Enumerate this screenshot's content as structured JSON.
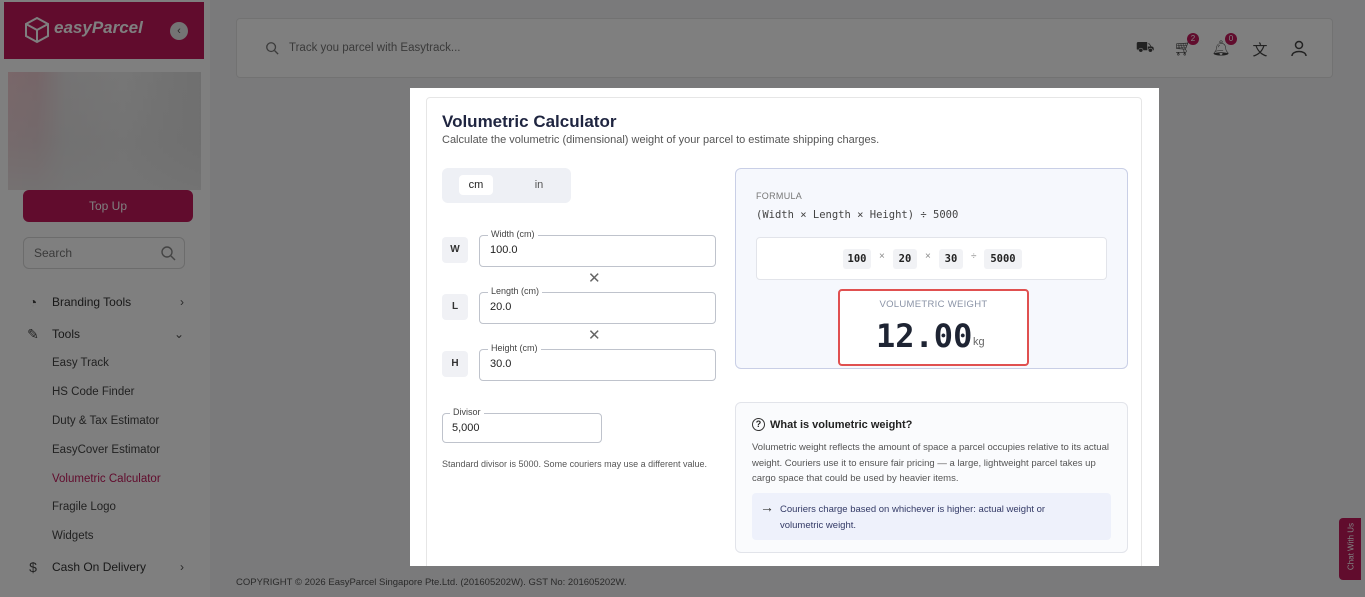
{
  "brand": {
    "name": "easyParcel"
  },
  "sidebar": {
    "topup_label": "Top Up",
    "search_placeholder": "Search",
    "items": [
      {
        "label": "Branding Tools",
        "icon": "palette-icon"
      },
      {
        "label": "Tools",
        "icon": "wrench-icon"
      },
      {
        "label": "Cash On Delivery",
        "icon": "dollar-icon"
      }
    ],
    "tools_subitems": [
      "Easy Track",
      "HS Code Finder",
      "Duty & Tax Estimator",
      "EasyCover Estimator",
      "Volumetric Calculator",
      "Fragile Logo",
      "Widgets"
    ]
  },
  "topbar": {
    "track_placeholder": "Track you parcel with Easytrack...",
    "cart_badge": "2",
    "bell_badge": "0"
  },
  "footer": {
    "text": "COPYRIGHT © 2026 EasyParcel Singapore Pte.Ltd. (201605202W). GST No: 201605202W."
  },
  "chat_label": "Chat With Us",
  "calculator": {
    "title": "Volumetric Calculator",
    "subtitle": "Calculate the volumetric (dimensional) weight of your parcel to estimate shipping charges.",
    "units": [
      "cm",
      "in"
    ],
    "selected_unit": "cm",
    "fields": [
      {
        "badge": "W",
        "label": "Width (cm)",
        "value": "100.0"
      },
      {
        "badge": "L",
        "label": "Length (cm)",
        "value": "20.0"
      },
      {
        "badge": "H",
        "label": "Height (cm)",
        "value": "30.0"
      }
    ],
    "times_symbol": "✕",
    "divisor": {
      "label": "Divisor",
      "value": "5,000"
    },
    "divisor_note": "Standard divisor is 5000. Some couriers may use a different value.",
    "formula": {
      "label": "FORMULA",
      "expression": "(Width × Length × Height) ÷ 5000",
      "values": [
        "100",
        "20",
        "30",
        "5000"
      ],
      "operators": [
        "×",
        "×",
        "÷"
      ]
    },
    "result": {
      "label": "VOLUMETRIC WEIGHT",
      "value": "12.00",
      "unit": "kg"
    },
    "info": {
      "title": "What is volumetric weight?",
      "text": "Volumetric weight reflects the amount of space a parcel occupies relative to its actual weight. Couriers use it to ensure fair pricing — a large, lightweight parcel takes up cargo space that could be used by heavier items.",
      "callout": "Couriers charge based on whichever is higher: actual weight or volumetric weight."
    }
  }
}
